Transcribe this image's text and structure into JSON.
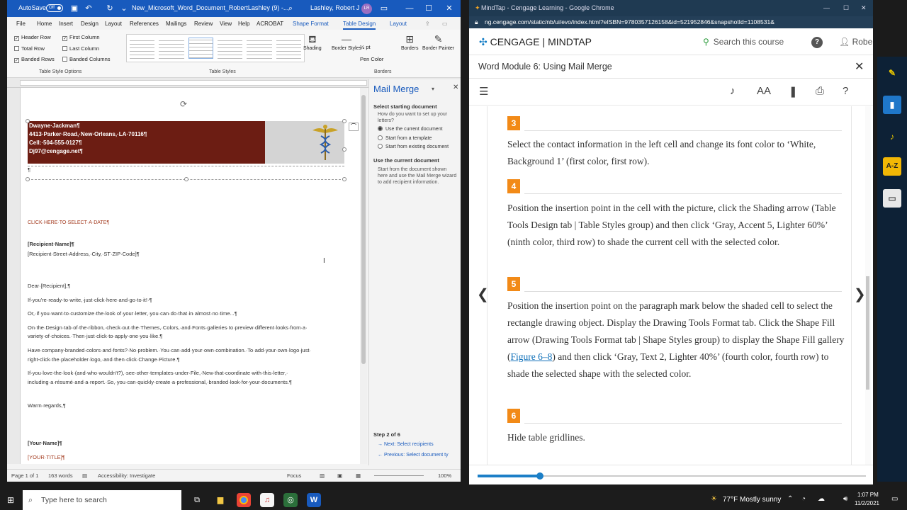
{
  "word": {
    "autosave": "AutoSave",
    "autosave_state": "Off",
    "doc_title": "New_Microsoft_Word_Document_RobertLashley (9) -...",
    "user": "Lashley, Robert J",
    "user_initials": "LR",
    "tabs": [
      "File",
      "Home",
      "Insert",
      "Design",
      "Layout",
      "References",
      "Mailings",
      "Review",
      "View",
      "Help",
      "ACROBAT",
      "Shape Format",
      "Table Design",
      "Layout"
    ],
    "active_tab": "Table Design",
    "style_options": {
      "header_row": "Header Row",
      "first_column": "First Column",
      "total_row": "Total Row",
      "last_column": "Last Column",
      "banded_rows": "Banded Rows",
      "banded_columns": "Banded Columns",
      "group_label": "Table Style Options"
    },
    "table_styles_label": "Table Styles",
    "shading": "Shading",
    "border_styles": "Border Styles",
    "pen_weight": "½ pt",
    "pen_color": "Pen Color",
    "borders": "Borders",
    "border_painter": "Border Painter",
    "borders_group": "Borders",
    "doc": {
      "name": "Dwayne·Jackman¶",
      "address": "4413·Parker·Road,·New·Orleans,·LA·70116¶",
      "cell": "Cell:·504-555-0127¶",
      "email": "Dj97@cengage.net¶",
      "para": "¶",
      "date": "CLICK·HERE·TO·SELECT·A·DATE¶",
      "recipient_name": "[Recipient·Name]¶",
      "recipient_address": "[Recipient·Street·Address,·City,·ST·ZIP·Code]¶",
      "salutation": "Dear·[Recipient],¶",
      "p1": "If·you're·ready·to·write,·just·click·here·and·go·to·it!·¶",
      "p2": "Or,·if·you·want·to·customize·the·look·of·your·letter,·you·can·do·that·in·almost·no·time...¶",
      "p3a": "On·the·Design·tab·of·the·ribbon,·check·out·the·Themes,·Colors,·and·Fonts·galleries·to·preview·different·looks·from·a·",
      "p3b": "variety·of·choices.·Then·just·click·to·apply·one·you·like.¶",
      "p4a": "Have·company-branded·colors·and·fonts?·No·problem.·You·can·add·your·own·combination.·To·add·your·own·logo·just·",
      "p4b": "right-click·the·placeholder·logo,·and·then·click·Change·Picture.¶",
      "p5a": "If·you·love·the·look·(and·who·wouldn't?),·see·other·templates·under·File,·New·that·coordinate·with·this·letter,·",
      "p5b": "including·a·résumé·and·a·report.·So,·you·can·quickly·create·a·professional,·branded·look·for·your·documents.¶",
      "closing": "Warm·regards,¶",
      "your_name": "[Your·Name]¶",
      "your_title": "[YOUR·TITLE]¶"
    },
    "mail_merge": {
      "title": "Mail Merge",
      "select_heading": "Select starting document",
      "select_q": "How do you want to set up your letters?",
      "opt1": "Use the current document",
      "opt2": "Start from a template",
      "opt3": "Start from existing document",
      "use_heading": "Use the current document",
      "use_text": "Start from the document shown here and use the Mail Merge wizard to add recipient information.",
      "step": "Step 2 of 6",
      "next": "Next: Select recipients",
      "prev": "Previous: Select document ty"
    },
    "status": {
      "page": "Page 1 of 1",
      "words": "163 words",
      "accessibility": "Accessibility: Investigate",
      "focus": "Focus",
      "zoom": "100%"
    }
  },
  "chrome": {
    "tab_title": "MindTap - Cengage Learning - Google Chrome",
    "url": "ng.cengage.com/static/nb/ui/evo/index.html?eISBN=9780357126158&id=521952846&snapshotId=1108531&",
    "brand": "CENGAGE",
    "product": "MINDTAP",
    "search": "Search this course",
    "user": "Robert",
    "module": "Word Module 6: Using Mail Merge",
    "steps": [
      {
        "num": "3",
        "text": "Select the contact information in the left cell and change its font color to ‘White, Background 1’ (first color, first row)."
      },
      {
        "num": "4",
        "text": "Position the insertion point in the cell with the picture, click the Shading arrow (Table Tools Design tab | Table Styles group) and then click ‘Gray, Accent 5, Lighter 60%’ (ninth color, third row) to shade the current cell with the selected color."
      },
      {
        "num": "5",
        "text_a": "Position the insertion point on the paragraph mark below the shaded cell to select the rectangle drawing object. Display the Drawing Tools Format tab. Click the Shape Fill arrow (Drawing Tools Format tab | Shape Styles group) to display the Shape Fill gallery (",
        "link": "Figure 6–8",
        "text_b": ") and then click ‘Gray, Text 2, Lighter 40%’ (fourth color, fourth row) to shade the selected shape with the selected color."
      },
      {
        "num": "6",
        "text": "Hide table gridlines."
      }
    ],
    "progress": 0.16
  },
  "taskbar": {
    "search": "Type here to search",
    "weather": "77°F  Mostly sunny",
    "time": "1:07 PM",
    "date": "11/2/2021"
  },
  "icons": [
    "windows-logo-icon",
    "search-icon",
    "task-view-icon",
    "file-explorer-icon",
    "chrome-icon",
    "itunes-icon",
    "snagit-icon",
    "word-icon"
  ]
}
